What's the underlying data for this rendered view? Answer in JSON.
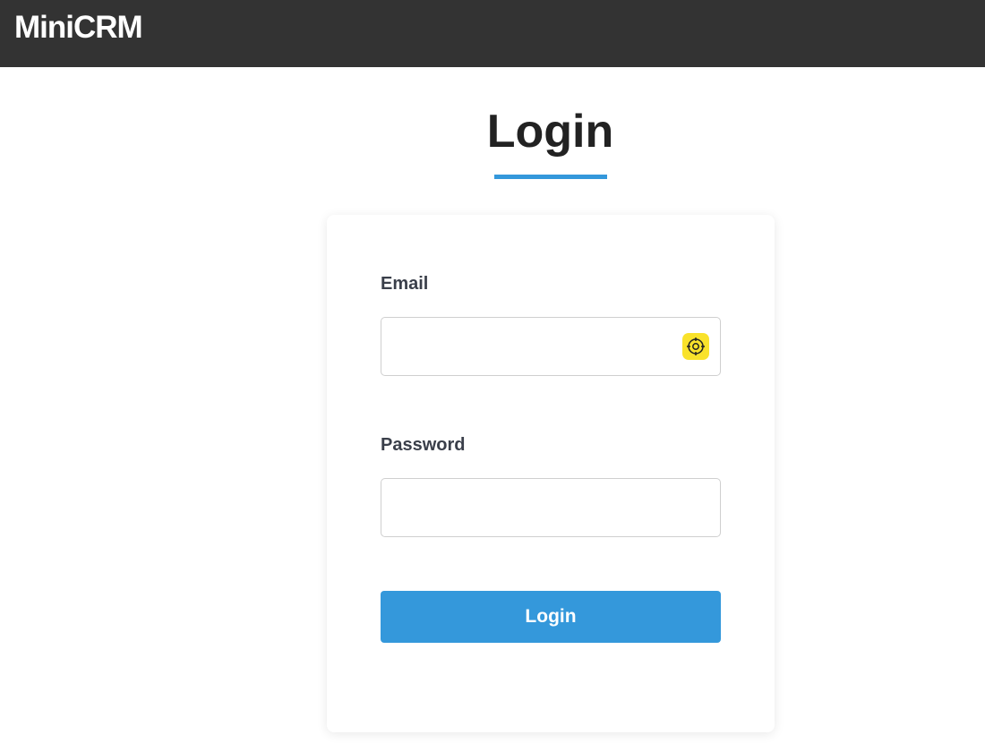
{
  "header": {
    "brand": "MiniCRM"
  },
  "page": {
    "title": "Login",
    "accent_color": "#3498db"
  },
  "form": {
    "email": {
      "label": "Email",
      "value": "",
      "placeholder": "",
      "autofill_icon": "crosshair-target-icon"
    },
    "password": {
      "label": "Password",
      "value": "",
      "placeholder": ""
    },
    "submit_label": "Login"
  }
}
